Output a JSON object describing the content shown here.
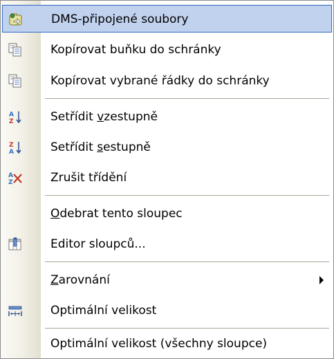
{
  "menu": {
    "items": [
      {
        "label": "DMS-připojené soubory",
        "icon": "dms-files-icon",
        "selected": true
      },
      {
        "label": "Kopírovat buňku do schránky",
        "icon": "copy-icon"
      },
      {
        "label": "Kopírovat vybrané řádky do schránky",
        "icon": "copy-icon"
      },
      {
        "label_parts": [
          "Setřídit ",
          "v",
          "zestupně"
        ],
        "icon": "sort-ascending-icon"
      },
      {
        "label_parts": [
          "Setřídit ",
          "s",
          "estupně"
        ],
        "icon": "sort-descending-icon"
      },
      {
        "label": "Zrušit třídění",
        "icon": "clear-sort-icon"
      },
      {
        "label_parts": [
          "",
          "O",
          "debrat tento sloupec"
        ]
      },
      {
        "label": "Editor sloupců...",
        "icon": "column-editor-icon"
      },
      {
        "label_parts": [
          "",
          "Z",
          "arovnání"
        ],
        "submenu_icon": "submenu-arrow-icon"
      },
      {
        "label": "Optimální velikost",
        "icon": "optimal-width-icon"
      },
      {
        "label": "Optimální velikost (všechny sloupce)"
      }
    ]
  },
  "colors": {
    "highlight": "#c1d2ee",
    "highlight_border": "#316ac5"
  }
}
